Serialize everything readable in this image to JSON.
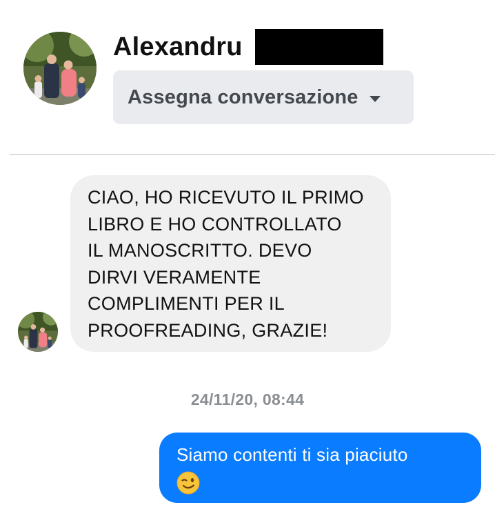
{
  "header": {
    "name": "Alexandru",
    "assign_label": "Assegna conversazione",
    "caret_icon": "caret-down-icon"
  },
  "conversation": {
    "incoming": {
      "lines": [
        "CIAO, HO RICEVUTO IL PRIMO",
        "LIBRO E HO CONTROLLATO",
        "IL MANOSCRITTO. DEVO",
        "DIRVI VERAMENTE",
        "COMPLIMENTI PER IL",
        "PROOFREADING, GRAZIE!"
      ]
    },
    "timestamp": "24/11/20, 08:44",
    "outgoing": {
      "text": "Siamo contenti ti sia piaciuto",
      "emoji_icon": "winking-face-emoji"
    }
  },
  "colors": {
    "outgoing_bubble": "#0a7cff",
    "incoming_bubble": "#f0f0f0",
    "assign_button": "#e9ebee",
    "timestamp": "#8a8d91"
  }
}
